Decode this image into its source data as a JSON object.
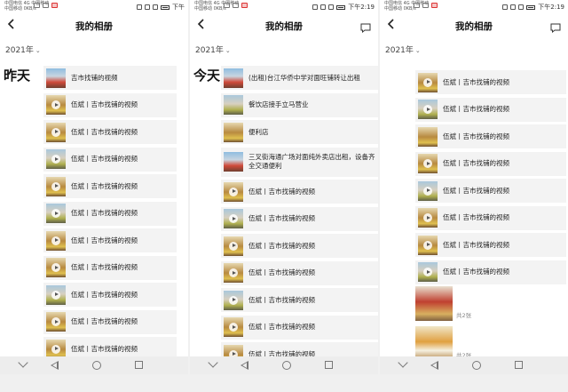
{
  "panels": [
    {
      "status": {
        "carrier_top": "中国电信 4G 中国移动",
        "carrier_bottom": "中国移动 0KB/s",
        "time": "下午"
      },
      "title": "我的相册",
      "year": "2021年",
      "day_label": "昨天",
      "items": [
        {
          "text": "吉市找铺的视频",
          "thumb": "shop",
          "play": false
        },
        {
          "text": "伍斌丨吉市找铺的视频",
          "thumb": "store",
          "play": true
        },
        {
          "text": "伍斌丨吉市找铺的视频",
          "thumb": "store",
          "play": true
        },
        {
          "text": "伍斌丨吉市找铺的视频",
          "thumb": "street",
          "play": true
        },
        {
          "text": "伍斌丨吉市找铺的视频",
          "thumb": "store",
          "play": true
        },
        {
          "text": "伍斌丨吉市找铺的视频",
          "thumb": "street",
          "play": true
        },
        {
          "text": "伍斌丨吉市找铺的视频",
          "thumb": "store",
          "play": true
        },
        {
          "text": "伍斌丨吉市找铺的视频",
          "thumb": "store",
          "play": true
        },
        {
          "text": "伍斌丨吉市找铺的视频",
          "thumb": "street",
          "play": true
        },
        {
          "text": "伍斌丨吉市找铺的视频",
          "thumb": "store",
          "play": true
        },
        {
          "text": "伍斌丨吉市找铺的视频",
          "thumb": "store",
          "play": true
        }
      ]
    },
    {
      "status": {
        "carrier_top": "中国电信 4G 中国移动",
        "carrier_bottom": "中国移动 0KB/s",
        "time": "下午2:19"
      },
      "title": "我的相册",
      "year": "2021年",
      "day_label": "今天",
      "items": [
        {
          "text": "(出租)台江华侨中学对面旺铺转让出租",
          "thumb": "shop",
          "play": false
        },
        {
          "text": "餐饮店接手立马营业",
          "thumb": "street",
          "play": false
        },
        {
          "text": "便利店",
          "thumb": "store",
          "play": false
        },
        {
          "text": "三叉街海通广场对面纯外卖店出租，设备齐全交通便利",
          "thumb": "shop",
          "play": false,
          "tall": true
        },
        {
          "text": "伍斌丨吉市找铺的视频",
          "thumb": "store",
          "play": true
        },
        {
          "text": "伍斌丨吉市找铺的视频",
          "thumb": "street",
          "play": true
        },
        {
          "text": "伍斌丨吉市找铺的视频",
          "thumb": "store",
          "play": true
        },
        {
          "text": "伍斌丨吉市找铺的视频",
          "thumb": "store",
          "play": true
        },
        {
          "text": "伍斌丨吉市找铺的视频",
          "thumb": "street",
          "play": true
        },
        {
          "text": "伍斌丨吉市找铺的视频",
          "thumb": "store",
          "play": true
        },
        {
          "text": "伍斌丨吉市找铺的视频",
          "thumb": "store",
          "play": true
        }
      ]
    },
    {
      "status": {
        "carrier_top": "中国电信 4G 中国移动",
        "carrier_bottom": "中国移动 0KB/s",
        "time": "下午2:19"
      },
      "title": "我的相册",
      "year": "2021年",
      "day_label": "",
      "items": [
        {
          "text": "伍斌丨吉市找铺的视频",
          "thumb": "store",
          "play": true
        },
        {
          "text": "伍斌丨吉市找铺的视频",
          "thumb": "street",
          "play": true
        },
        {
          "text": "伍斌丨吉市找铺的视频",
          "thumb": "store",
          "play": false
        },
        {
          "text": "伍斌丨吉市找铺的视频",
          "thumb": "store",
          "play": true
        },
        {
          "text": "伍斌丨吉市找铺的视频",
          "thumb": "street",
          "play": true
        },
        {
          "text": "伍斌丨吉市找铺的视频",
          "thumb": "store",
          "play": true
        },
        {
          "text": "伍斌丨吉市找铺的视频",
          "thumb": "store",
          "play": true
        },
        {
          "text": "伍斌丨吉市找铺的视频",
          "thumb": "street",
          "play": true
        }
      ],
      "photo_posts": [
        {
          "count": "共2张"
        },
        {
          "count": "共2张"
        }
      ]
    }
  ],
  "colors": {
    "background": "#f0f0f0",
    "panel": "#ffffff",
    "row": "#f3f3f3",
    "navbar": "#ededed"
  }
}
